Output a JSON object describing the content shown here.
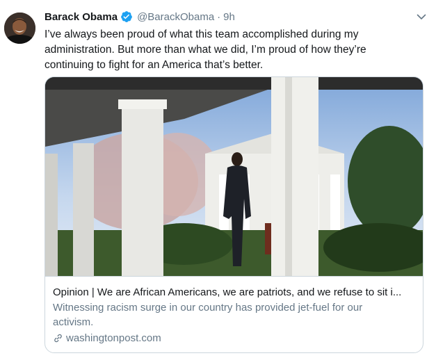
{
  "tweet": {
    "display_name": "Barack Obama",
    "handle": "@BarackObama",
    "separator": "·",
    "time": "9h",
    "text_lines": [
      "I’ve always been proud of what this team accomplished during my",
      "administration. But more than what we did, I’m proud of how they’re",
      "continuing to fight for an America that’s better."
    ]
  },
  "card": {
    "title": "Opinion | We are African Americans, we are patriots, and we refuse to sit i...",
    "description_lines": [
      "Witnessing racism surge in our country has provided jet-fuel for our",
      "activism."
    ],
    "domain": "washingtonpost.com"
  },
  "icons": {
    "verified": "verified-badge-icon",
    "caret": "chevron-down-icon",
    "link": "link-icon"
  },
  "colors": {
    "text_primary": "#14171a",
    "text_secondary": "#657786",
    "verified_blue": "#1da1f2",
    "border": "#ccd6dd"
  }
}
